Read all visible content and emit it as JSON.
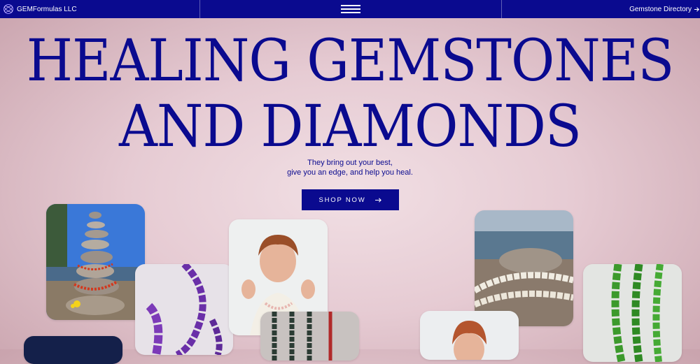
{
  "header": {
    "brand_name": "GEMFormulas LLC",
    "logo_icon": "gem-orbit-logo",
    "menu_icon": "hamburger-menu-icon",
    "directory_link": "Gemstone Directory",
    "directory_icon": "arrow-right-icon"
  },
  "hero": {
    "title_line1": "HEALING GEMSTONES",
    "title_line2": "AND DIAMONDS",
    "tagline_line1": "They bring out your best,",
    "tagline_line2": "give you an edge, and help you heal.",
    "cta_label": "SHOP NOW",
    "cta_icon": "arrow-right-icon"
  },
  "colors": {
    "brand": "#0a0a8f",
    "background": "#e6cbd3"
  }
}
